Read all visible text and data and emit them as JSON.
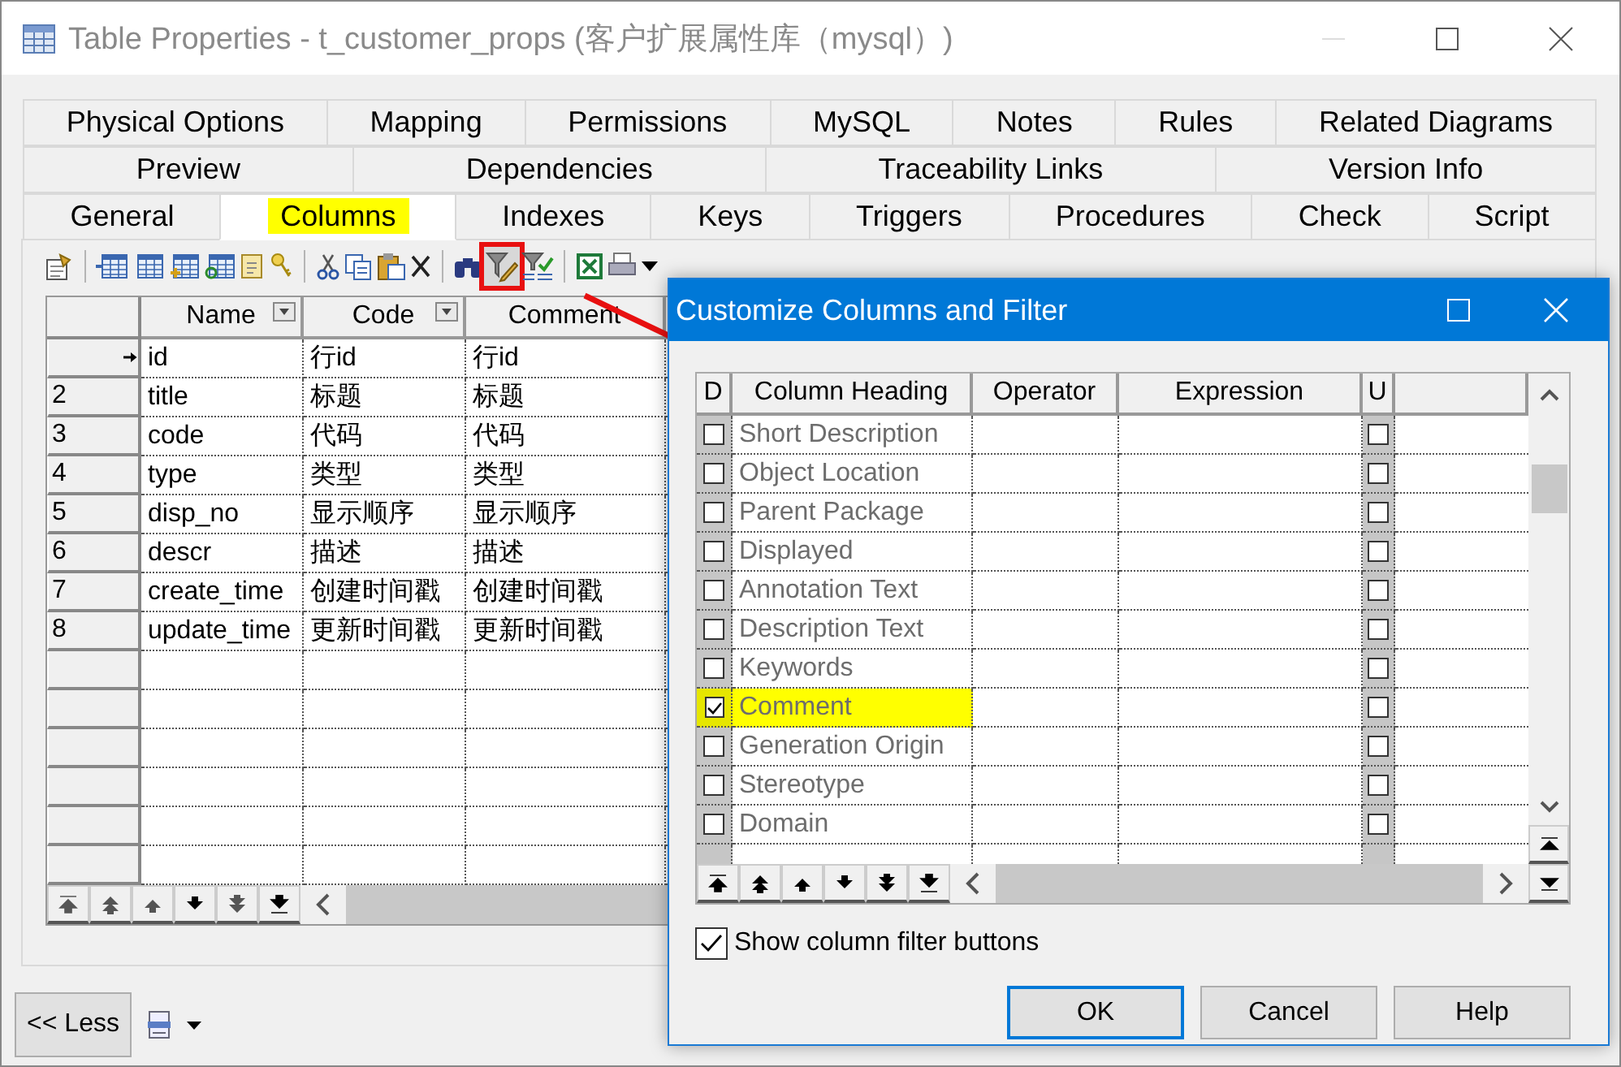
{
  "window": {
    "title": "Table Properties - t_customer_props (客户扩展属性库（mysql）)"
  },
  "tab_rows": [
    [
      {
        "label": "Physical Options",
        "selected": false,
        "highlighted": false
      },
      {
        "label": "Mapping",
        "selected": false,
        "highlighted": false
      },
      {
        "label": "Permissions",
        "selected": false,
        "highlighted": false
      },
      {
        "label": "MySQL",
        "selected": false,
        "highlighted": false
      },
      {
        "label": "Notes",
        "selected": false,
        "highlighted": false
      },
      {
        "label": "Rules",
        "selected": false,
        "highlighted": false
      },
      {
        "label": "Related Diagrams",
        "selected": false,
        "highlighted": false
      }
    ],
    [
      {
        "label": "Preview",
        "selected": false,
        "highlighted": false
      },
      {
        "label": "Dependencies",
        "selected": false,
        "highlighted": false
      },
      {
        "label": "Traceability Links",
        "selected": false,
        "highlighted": false
      },
      {
        "label": "Version Info",
        "selected": false,
        "highlighted": false
      }
    ],
    [
      {
        "label": "General",
        "selected": false,
        "highlighted": false
      },
      {
        "label": "Columns",
        "selected": true,
        "highlighted": true
      },
      {
        "label": "Indexes",
        "selected": false,
        "highlighted": false
      },
      {
        "label": "Keys",
        "selected": false,
        "highlighted": false
      },
      {
        "label": "Triggers",
        "selected": false,
        "highlighted": false
      },
      {
        "label": "Procedures",
        "selected": false,
        "highlighted": false
      },
      {
        "label": "Check",
        "selected": false,
        "highlighted": false
      },
      {
        "label": "Script",
        "selected": false,
        "highlighted": false
      }
    ]
  ],
  "toolbar": [
    {
      "kind": "properties",
      "marked": false
    },
    {
      "kind": "separator"
    },
    {
      "kind": "insert-row",
      "marked": false
    },
    {
      "kind": "add-row",
      "marked": false
    },
    {
      "kind": "add-columns",
      "marked": false
    },
    {
      "kind": "reuse-columns",
      "marked": false
    },
    {
      "kind": "note",
      "marked": false
    },
    {
      "kind": "key",
      "marked": false
    },
    {
      "kind": "separator"
    },
    {
      "kind": "cut",
      "marked": false
    },
    {
      "kind": "copy",
      "marked": false
    },
    {
      "kind": "paste",
      "marked": false
    },
    {
      "kind": "delete",
      "marked": false
    },
    {
      "kind": "separator"
    },
    {
      "kind": "find",
      "marked": false
    },
    {
      "kind": "filter-edit",
      "marked": true
    },
    {
      "kind": "filter-check",
      "marked": false
    },
    {
      "kind": "separator"
    },
    {
      "kind": "excel",
      "marked": false
    },
    {
      "kind": "print",
      "marked": false
    },
    {
      "kind": "dropdown",
      "marked": false
    }
  ],
  "grid": {
    "columns": [
      {
        "label": "Name",
        "filter_button": true
      },
      {
        "label": "Code",
        "filter_button": true
      },
      {
        "label": "Comment",
        "filter_button": false
      }
    ],
    "rows": [
      {
        "number": "",
        "current": true,
        "cells": [
          "id",
          "行id",
          "行id"
        ]
      },
      {
        "number": "2",
        "current": false,
        "cells": [
          "title",
          "标题",
          "标题"
        ]
      },
      {
        "number": "3",
        "current": false,
        "cells": [
          "code",
          "代码",
          "代码"
        ]
      },
      {
        "number": "4",
        "current": false,
        "cells": [
          "type",
          "类型",
          "类型"
        ]
      },
      {
        "number": "5",
        "current": false,
        "cells": [
          "disp_no",
          "显示顺序",
          "显示顺序"
        ]
      },
      {
        "number": "6",
        "current": false,
        "cells": [
          "descr",
          "描述",
          "描述"
        ]
      },
      {
        "number": "7",
        "current": false,
        "cells": [
          "create_time",
          "创建时间戳",
          "创建时间戳"
        ]
      },
      {
        "number": "8",
        "current": false,
        "cells": [
          "update_time",
          "更新时间戳",
          "更新时间戳"
        ]
      }
    ]
  },
  "less_button": "<< Less",
  "dialog": {
    "title": "Customize Columns and Filter",
    "columns": [
      "D",
      "Column Heading",
      "Operator",
      "Expression",
      "U"
    ],
    "rows": [
      {
        "label": "Short Description",
        "displayed": false,
        "highlighted": false,
        "u": false
      },
      {
        "label": "Object Location",
        "displayed": false,
        "highlighted": false,
        "u": false
      },
      {
        "label": "Parent Package",
        "displayed": false,
        "highlighted": false,
        "u": false
      },
      {
        "label": "Displayed",
        "displayed": false,
        "highlighted": false,
        "u": false
      },
      {
        "label": "Annotation Text",
        "displayed": false,
        "highlighted": false,
        "u": false
      },
      {
        "label": "Description Text",
        "displayed": false,
        "highlighted": false,
        "u": false
      },
      {
        "label": "Keywords",
        "displayed": false,
        "highlighted": false,
        "u": false
      },
      {
        "label": "Comment",
        "displayed": true,
        "highlighted": true,
        "u": false
      },
      {
        "label": "Generation Origin",
        "displayed": false,
        "highlighted": false,
        "u": false
      },
      {
        "label": "Stereotype",
        "displayed": false,
        "highlighted": false,
        "u": false
      },
      {
        "label": "Domain",
        "displayed": false,
        "highlighted": false,
        "u": false
      }
    ],
    "show_filter_buttons": {
      "label": "Show column filter buttons",
      "checked": true
    },
    "buttons": [
      {
        "label": "OK",
        "default": true
      },
      {
        "label": "Cancel",
        "default": false
      },
      {
        "label": "Help",
        "default": false
      }
    ]
  }
}
